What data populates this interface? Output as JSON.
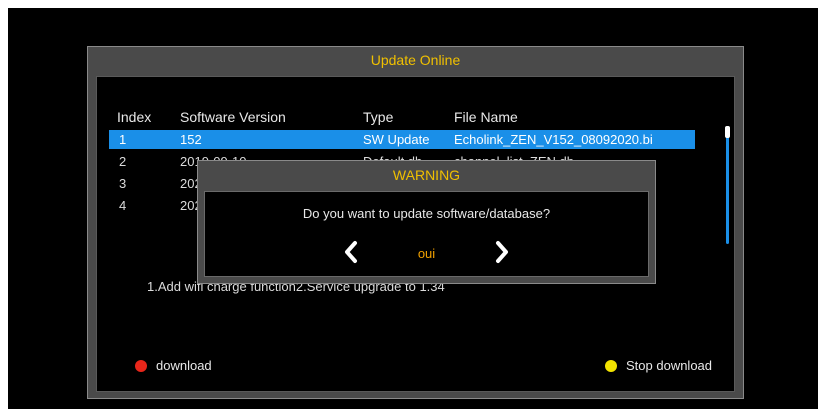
{
  "panel": {
    "title": "Update Online"
  },
  "table": {
    "headers": [
      "Index",
      "Software Version",
      "Type",
      "File Name"
    ],
    "rows": [
      {
        "index": "1",
        "version": "152",
        "type": "SW Update",
        "file": "Echolink_ZEN_V152_08092020.bi",
        "selected": true
      },
      {
        "index": "2",
        "version": "2019-09-10",
        "type": "Default db",
        "file": "channel_list_ZEN.db",
        "selected": false
      },
      {
        "index": "3",
        "version": "202",
        "type": "",
        "file": "",
        "selected": false
      },
      {
        "index": "4",
        "version": "202",
        "type": "",
        "file": "",
        "selected": false
      }
    ]
  },
  "notes": "1.Add wifi charge function2.Service upgrade to 1.34",
  "legend": {
    "download": {
      "label": "download",
      "color": "#e8261a"
    },
    "stop": {
      "label": "Stop download",
      "color": "#f2e200"
    }
  },
  "dialog": {
    "title": "WARNING",
    "message": "Do you want to update software/database?",
    "option": "oui",
    "left_icon": "chevron-left-icon",
    "right_icon": "chevron-right-icon"
  },
  "colors": {
    "accent": "#1a8fe8",
    "title": "#f0c000",
    "option": "#f0a000"
  }
}
